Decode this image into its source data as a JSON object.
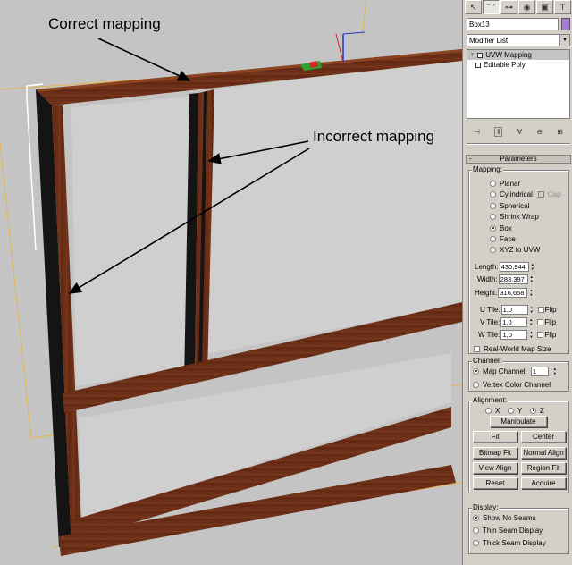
{
  "annotations": {
    "correct": "Correct mapping",
    "incorrect": "Incorrect mapping"
  },
  "colors": {
    "viewport_bg": "#c4c4c4",
    "wood": "#6b2e16",
    "wood_dark": "#3a1508",
    "wood_black": "#141414",
    "guide_orange": "#e8b24a",
    "object_color": "#a27cd6",
    "panel_bg": "#d4d0c8"
  },
  "tabs": [
    {
      "icon": "create-icon",
      "glyph": "↖"
    },
    {
      "icon": "modify-icon",
      "glyph": "⌒"
    },
    {
      "icon": "hierarchy-icon",
      "glyph": "⊶"
    },
    {
      "icon": "motion-icon",
      "glyph": "◉"
    },
    {
      "icon": "display-icon",
      "glyph": "▣"
    },
    {
      "icon": "utilities-icon",
      "glyph": "T"
    }
  ],
  "object_name": "Box13",
  "modifier_list": "Modifier List",
  "stack": [
    {
      "label": "UVW Mapping",
      "selected": true
    },
    {
      "label": "Editable Poly",
      "selected": false
    }
  ],
  "parameters": {
    "title": "Parameters",
    "mapping_label": "Mapping:",
    "mapping_options": [
      {
        "label": "Planar",
        "on": false
      },
      {
        "label": "Cylindrical",
        "on": false
      },
      {
        "label": "Spherical",
        "on": false
      },
      {
        "label": "Shrink Wrap",
        "on": false
      },
      {
        "label": "Box",
        "on": true
      },
      {
        "label": "Face",
        "on": false
      },
      {
        "label": "XYZ to UVW",
        "on": false
      }
    ],
    "cap_label": "Cap",
    "length_label": "Length:",
    "length_value": "430,944",
    "width_label": "Width:",
    "width_value": "283,397",
    "height_label": "Height:",
    "height_value": "316,658",
    "u_tile_label": "U Tile:",
    "u_tile_value": "1,0",
    "v_tile_label": "V Tile:",
    "v_tile_value": "1,0",
    "w_tile_label": "W Tile:",
    "w_tile_value": "1,0",
    "flip_label": "Flip",
    "real_world_label": "Real-World Map Size"
  },
  "channel": {
    "label": "Channel:",
    "map_channel_label": "Map Channel:",
    "map_channel_value": "1",
    "vertex_color_label": "Vertex Color Channel"
  },
  "alignment": {
    "label": "Alignment:",
    "x": "X",
    "y": "Y",
    "z": "Z",
    "manipulate": "Manipulate",
    "fit": "Fit",
    "center": "Center",
    "bitmap_fit": "Bitmap Fit",
    "normal_align": "Normal Align",
    "view_align": "View Align",
    "region_fit": "Region Fit",
    "reset": "Reset",
    "acquire": "Acquire"
  },
  "display": {
    "label": "Display:",
    "show_no_seams": "Show No Seams",
    "thin_seam": "Thin Seam Display",
    "thick_seam": "Thick Seam Display"
  }
}
